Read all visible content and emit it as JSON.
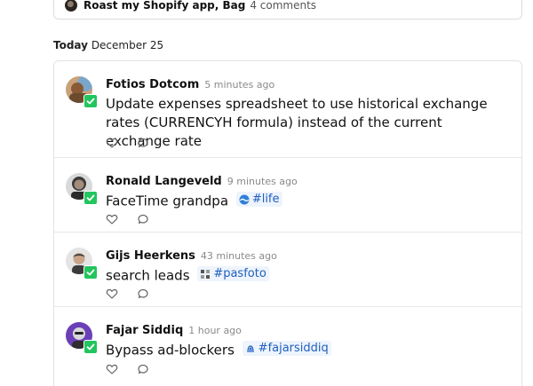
{
  "top_card": {
    "title": "Roast my Shopify app, Bag",
    "comments": "4 comments"
  },
  "date_header": {
    "day": "Today",
    "date": "December 25"
  },
  "entries": [
    {
      "author": "Fotios Dotcom",
      "time": "5 minutes ago",
      "text": "Update expenses spreadsheet to use historical exchange rates (CURRENCYH formula) instead of the current exchange rate",
      "tag": ""
    },
    {
      "author": "Ronald Langeveld",
      "time": "9 minutes ago",
      "text": "FaceTime grandpa",
      "tag": "#life"
    },
    {
      "author": "Gijs Heerkens",
      "time": "43 minutes ago",
      "text": "search leads",
      "tag": "#pasfoto"
    },
    {
      "author": "Fajar Siddiq",
      "time": "1 hour ago",
      "text": "Bypass ad-blockers",
      "tag": "#fajarsiddiq"
    }
  ],
  "icons": {
    "completed": "checkmark-icon",
    "like": "heart-icon",
    "comment": "comment-bubble-icon"
  },
  "colors": {
    "done_badge": "#22c55e",
    "tag_text": "#1f5fbf",
    "tag_bg": "#eef4fc"
  }
}
